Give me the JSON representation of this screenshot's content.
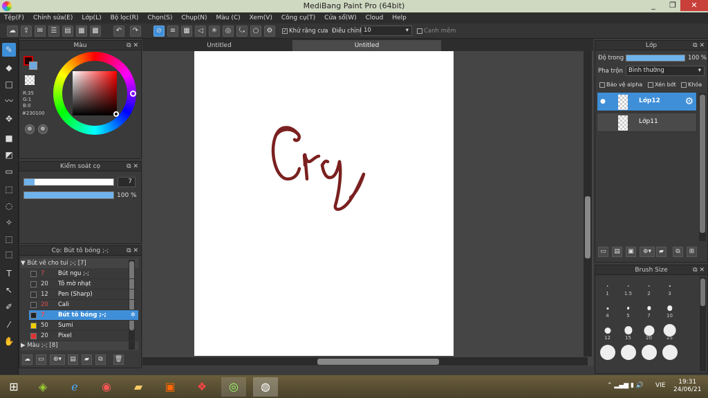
{
  "app": {
    "title": "MediBang Paint Pro (64bit)",
    "minimize": "_",
    "maximize": "❐",
    "close": "✕"
  },
  "menu": [
    "Tệp(F)",
    "Chỉnh sửa(E)",
    "Lớp(L)",
    "Bộ lọc(R)",
    "Chọn(S)",
    "Chụp(N)",
    "Màu (C)",
    "Xem(V)",
    "Công cụ(T)",
    "Cửa sổ(W)",
    "Cloud",
    "Help"
  ],
  "toolbar": {
    "antialias_label": "Khử răng cưa",
    "adjust_label": "Điều chỉnh",
    "adjust_value": "10",
    "edge_label": "Canh mềm"
  },
  "color_panel": {
    "title": "Màu",
    "r": "R:35",
    "g": "G:1",
    "b": "B:0",
    "hex": "#230100",
    "fg": "#230100",
    "bg": "#6fa8dc"
  },
  "brush_control": {
    "title": "Kiểm soát cọ",
    "size_value": "7",
    "size_fraction": 0.12,
    "opacity_label": "100 %",
    "opacity_fraction": 1.0
  },
  "brush_list": {
    "title": "Cọ: Bút tô bóng ;-;",
    "group1": "Bút vẽ cho tui ;-; [7]",
    "group2": "Màu ;-; [8]",
    "items": [
      {
        "size": "7",
        "name": "Bút ngu ;-;",
        "color": "#333333"
      },
      {
        "size": "20",
        "name": "Tô mờ nhạt",
        "color": "#333333"
      },
      {
        "size": "12",
        "name": "Pen (Sharp)",
        "color": "#333333"
      },
      {
        "size": "20",
        "name": "Cali",
        "color": "#333333"
      },
      {
        "size": "7",
        "name": "Bút tô bóng ;-;",
        "color": "#222222",
        "selected": true
      },
      {
        "size": "50",
        "name": "Sumi",
        "color": "#f0d000"
      },
      {
        "size": "20",
        "name": "Pixel",
        "color": "#e03030"
      }
    ]
  },
  "canvas": {
    "tab1": "Untitled",
    "tab2": "Untitled",
    "stroke_color": "#7a2020"
  },
  "layer_panel": {
    "title": "Lớp",
    "opacity_label": "Độ trong",
    "opacity_value": "100 %",
    "opacity_fraction": 1.0,
    "blend_label": "Pha trộn",
    "blend_value": "Bình thường",
    "protect_alpha": "Bảo vệ alpha",
    "clipping": "Xén bớt",
    "lock": "Khóa",
    "layers": [
      {
        "name": "Lớp12",
        "selected": true
      },
      {
        "name": "Lớp11",
        "selected": false
      }
    ]
  },
  "brush_size_panel": {
    "title": "Brush Size",
    "sizes": [
      {
        "label": "1",
        "value": 1
      },
      {
        "label": "1.5",
        "value": 1.5
      },
      {
        "label": "2",
        "value": 2
      },
      {
        "label": "3",
        "value": 3
      },
      {
        "label": "4",
        "value": 4
      },
      {
        "label": "5",
        "value": 5
      },
      {
        "label": "7",
        "value": 7
      },
      {
        "label": "10",
        "value": 10
      },
      {
        "label": "12",
        "value": 12
      },
      {
        "label": "15",
        "value": 15
      },
      {
        "label": "20",
        "value": 20
      },
      {
        "label": "25",
        "value": 25
      },
      {
        "label": "",
        "value": 30
      },
      {
        "label": "",
        "value": 35
      },
      {
        "label": "",
        "value": 40
      },
      {
        "label": "",
        "value": 45
      }
    ]
  },
  "taskbar": {
    "lang": "VIE",
    "time": "19:31",
    "date": "24/06/21"
  }
}
